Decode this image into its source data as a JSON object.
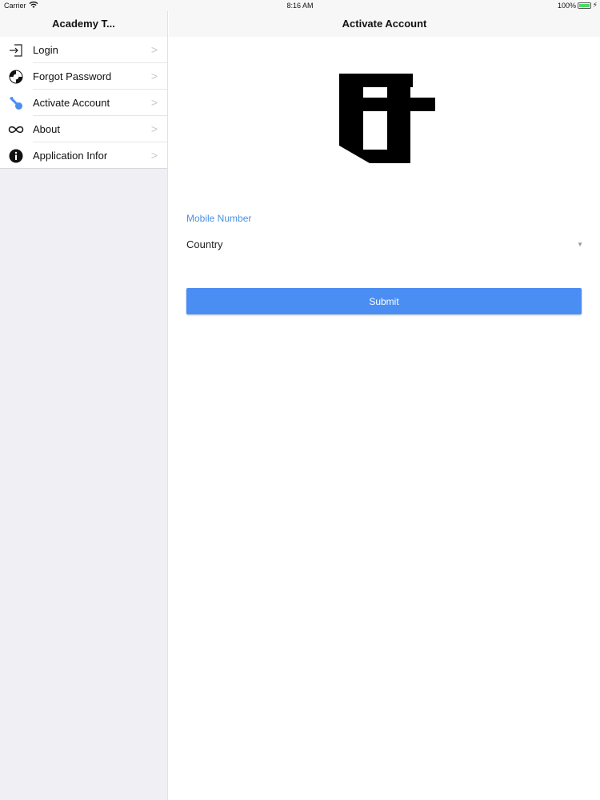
{
  "status_bar": {
    "carrier": "Carrier",
    "time": "8:16 AM",
    "battery": "100%"
  },
  "sidebar": {
    "title": "Academy T...",
    "items": [
      {
        "label": "Login",
        "icon": "login-icon"
      },
      {
        "label": "Forgot Password",
        "icon": "lifebuoy-icon"
      },
      {
        "label": "Activate Account",
        "icon": "key-icon"
      },
      {
        "label": "About",
        "icon": "infinity-icon"
      },
      {
        "label": "Application Infor",
        "icon": "info-icon"
      }
    ]
  },
  "main": {
    "title": "Activate Account",
    "mobile_label": "Mobile Number",
    "country_placeholder": "Country",
    "submit_label": "Submit"
  },
  "colors": {
    "accent": "#4a8ef4",
    "label_blue": "#4a90e2",
    "sidebar_bg": "#efeff4"
  }
}
